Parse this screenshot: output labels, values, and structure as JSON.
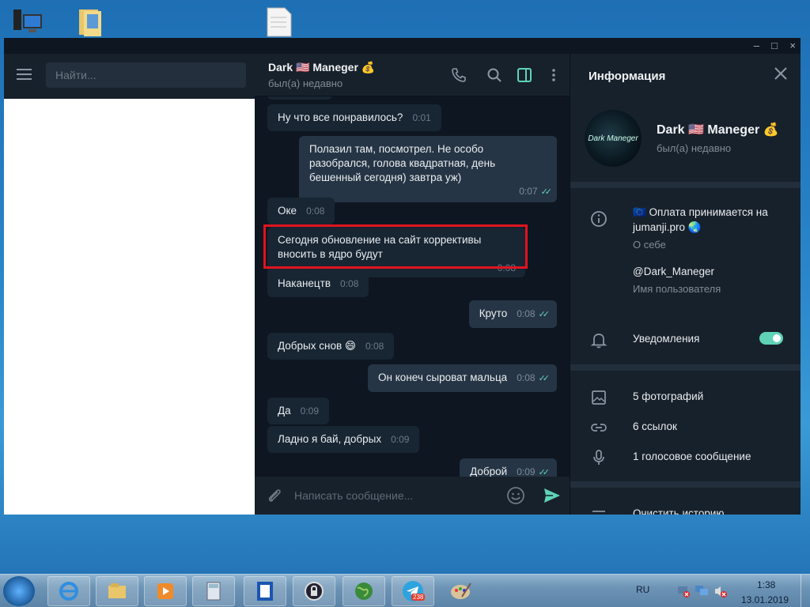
{
  "window": {
    "controls": {
      "minimize": "–",
      "maximize": "□",
      "close": "×"
    }
  },
  "left_panel": {
    "search_placeholder": "Найти..."
  },
  "chat": {
    "name": "Dark 🇺🇸 Maneger 💰",
    "status": "был(а) недавно",
    "composer_placeholder": "Написать сообщение...",
    "messages": [
      {
        "dir": "in",
        "text": "Ну что все понравилось?",
        "time": "0:01"
      },
      {
        "dir": "out",
        "text": "Полазил там, посмотрел. Не особо разобрался, голова квадратная, день бешенный сегодня) завтра уж)",
        "time": "0:07"
      },
      {
        "dir": "in",
        "text": "Оке",
        "time": "0:08"
      },
      {
        "dir": "in",
        "text": "Сегодня обновление на сайт коррективы вносить в ядро будут",
        "time": "0:08"
      },
      {
        "dir": "in",
        "text": "Наканецтв",
        "time": "0:08"
      },
      {
        "dir": "out",
        "text": "Круто",
        "time": "0:08"
      },
      {
        "dir": "in",
        "text": "Добрых снов 😄",
        "time": "0:08"
      },
      {
        "dir": "out",
        "text": "Он конеч сыроват мальца",
        "time": "0:08"
      },
      {
        "dir": "in",
        "text": "Да",
        "time": "0:09"
      },
      {
        "dir": "in",
        "text": "Ладно я бай, добрых",
        "time": "0:09"
      },
      {
        "dir": "out",
        "text": "Доброй",
        "time": "0:09"
      }
    ]
  },
  "info": {
    "title": "Информация",
    "avatar_text": "Dark Maneger",
    "name": "Dark 🇺🇸 Maneger 💰",
    "status": "был(а) недавно",
    "bio_line1": "🇪🇺 Оплата принимается на",
    "bio_line2": "jumanji.pro 🌏",
    "bio_label": "О себе",
    "username": "@Dark_Maneger",
    "username_label": "Имя пользователя",
    "notifications": "Уведомления",
    "notifications_on": true,
    "photos": "5 фотографий",
    "links": "6 ссылок",
    "voice": "1 голосовое сообщение",
    "clear_history": "Очистить историю"
  },
  "taskbar": {
    "language": "RU",
    "time": "1:38",
    "date": "13.01.2019",
    "telegram_badge": "238"
  },
  "colors": {
    "accent": "#5fd3b6",
    "highlight_box": "#e0141f",
    "incoming_bubble": "#182533",
    "outgoing_bubble": "#263545"
  }
}
